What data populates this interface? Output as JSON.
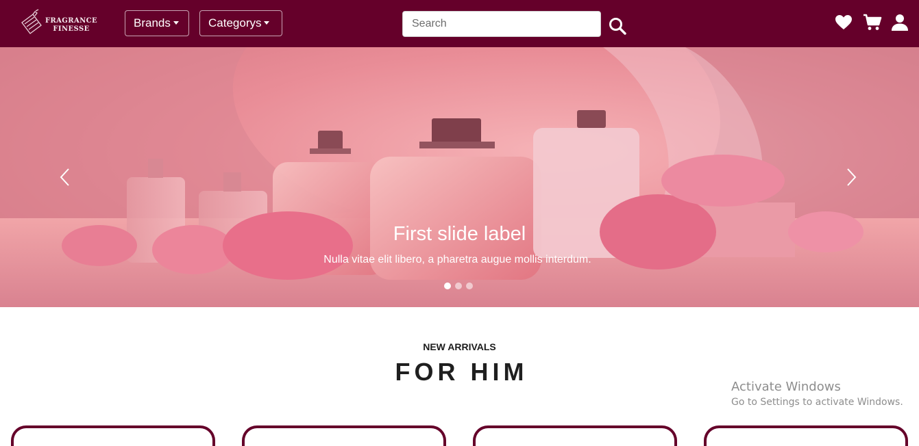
{
  "brand": {
    "line1": "FRAGRANCE",
    "line2": "FINESSE"
  },
  "nav": {
    "brands_label": "Brands",
    "categories_label": "Categorys",
    "search_placeholder": "Search",
    "icons": [
      "heart-icon",
      "cart-icon",
      "user-icon"
    ]
  },
  "carousel": {
    "slide_title": "First slide label",
    "slide_text": "Nulla vitae elit libero, a pharetra augue mollis interdum.",
    "indicator_count": 3,
    "active_index": 0
  },
  "section": {
    "subtitle": "NEW ARRIVALS",
    "title": "FOR HIM"
  },
  "watermark": {
    "title": "Activate Windows",
    "subtitle": "Go to Settings to activate Windows."
  },
  "colors": {
    "navbar": "#65002a",
    "accent": "#65002a"
  }
}
